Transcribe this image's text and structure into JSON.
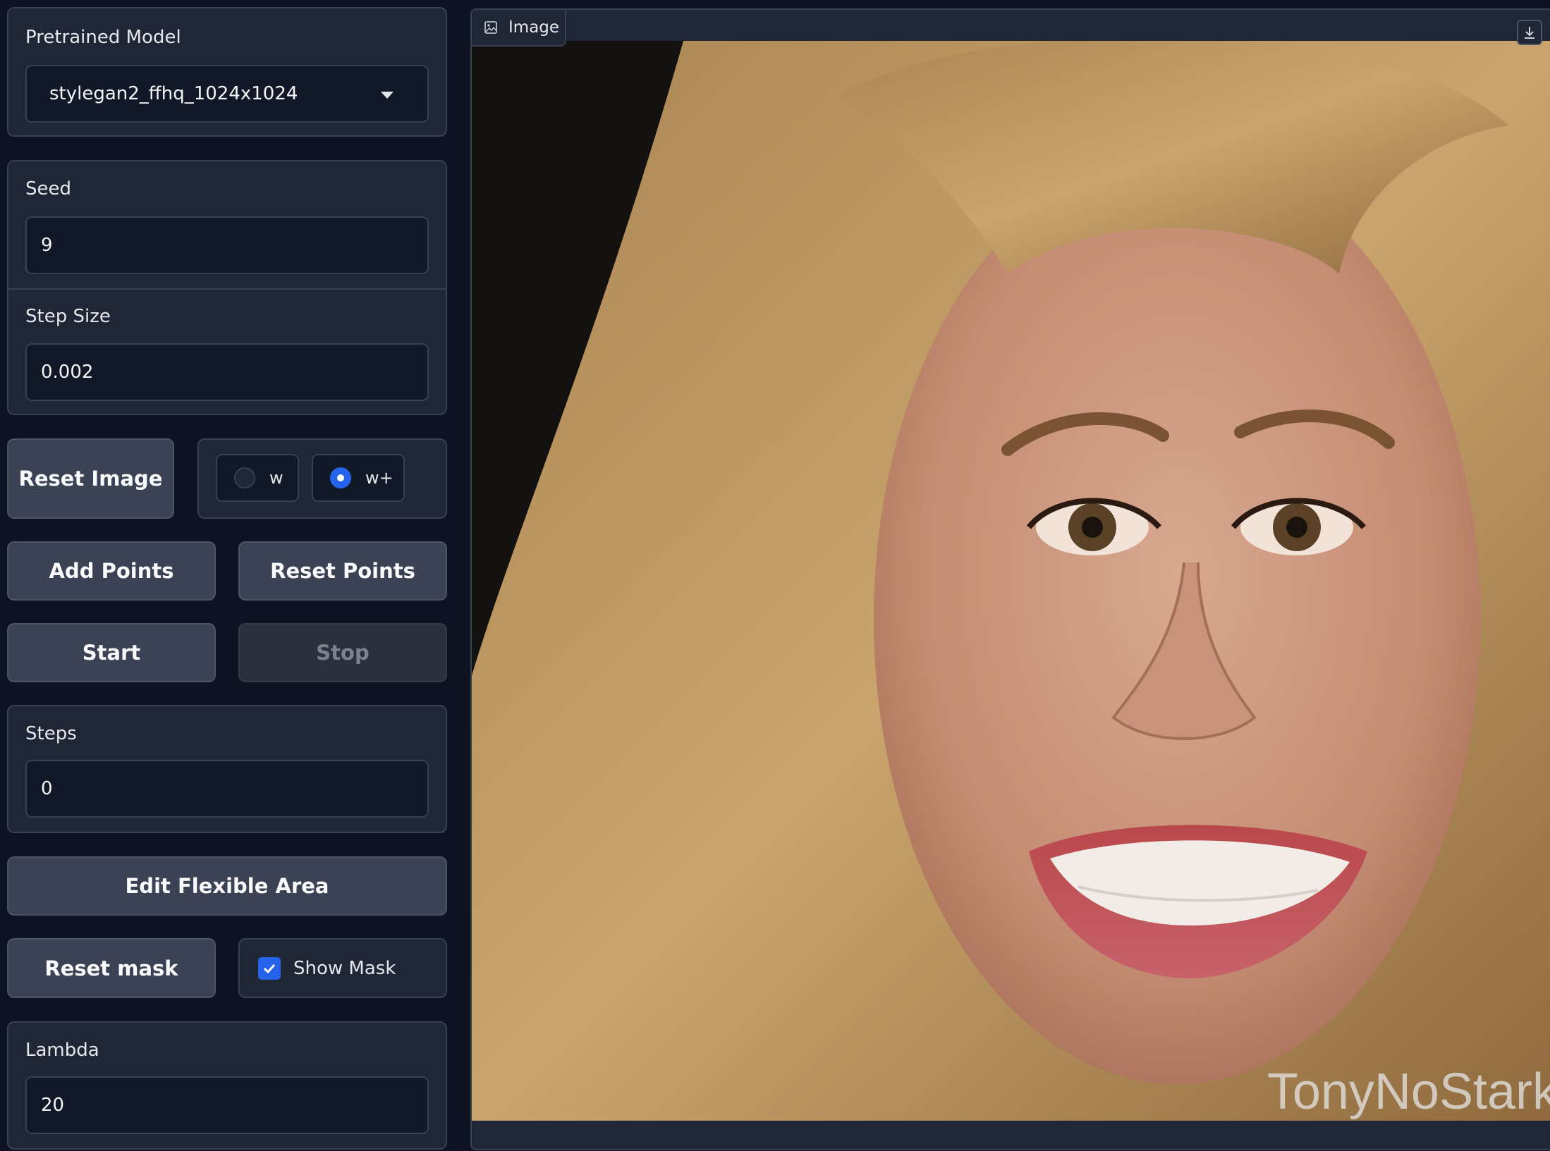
{
  "left_panel": {
    "model": {
      "label": "Pretrained Model",
      "value": "stylegan2_ffhq_1024x1024"
    },
    "seed": {
      "label": "Seed",
      "value": "9"
    },
    "step_size": {
      "label": "Step Size",
      "value": "0.002"
    },
    "reset_image_label": "Reset Image",
    "latent_space": {
      "options": [
        "w",
        "w+"
      ],
      "selected": "w+"
    },
    "add_points_label": "Add Points",
    "reset_points_label": "Reset Points",
    "start_label": "Start",
    "stop_label": "Stop",
    "steps": {
      "label": "Steps",
      "value": "0"
    },
    "edit_flexible_area_label": "Edit Flexible Area",
    "reset_mask_label": "Reset mask",
    "show_mask": {
      "label": "Show Mask",
      "checked": true
    },
    "lambda": {
      "label": "Lambda",
      "value": "20"
    }
  },
  "image_panel": {
    "tab_label": "Image",
    "watermark": "TonyNoStark"
  },
  "colors": {
    "accent": "#2563eb",
    "panel_bg": "#1f2636",
    "page_bg": "#0d1320"
  },
  "icons": {
    "dropdown": "caret-down-icon",
    "image_tab": "image-icon",
    "download": "download-icon"
  }
}
